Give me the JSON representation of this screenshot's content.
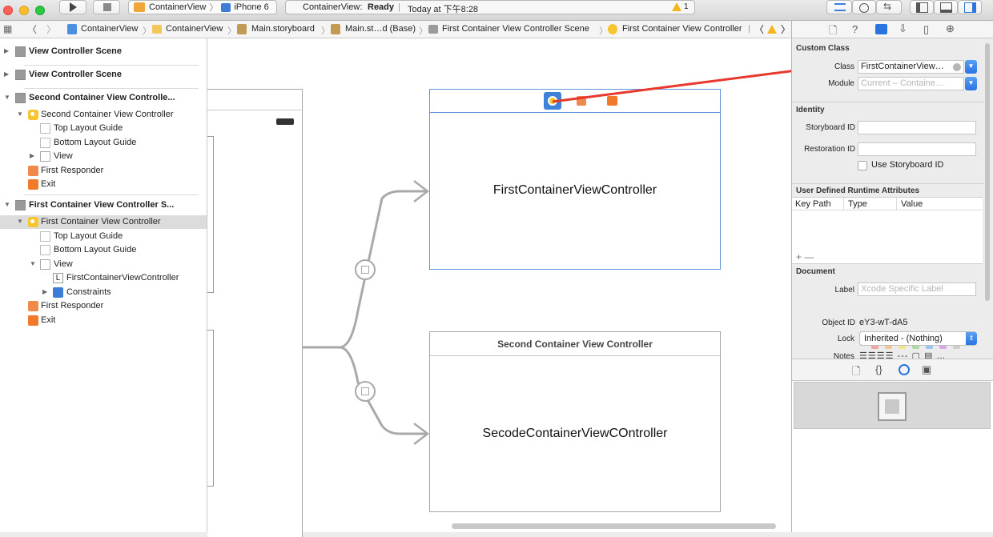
{
  "toolbar": {
    "scheme_project": "ContainerView",
    "scheme_device": "iPhone 6",
    "status_app": "ContainerView:",
    "status_state": "Ready",
    "status_time": "Today at 下午8:28",
    "warning_count": "1"
  },
  "jumpbar": {
    "crumbs": [
      "ContainerView",
      "ContainerView",
      "Main.storyboard",
      "Main.st…d (Base)",
      "First Container View Controller Scene",
      "First Container View Controller"
    ]
  },
  "outline": {
    "rows": [
      "View Controller Scene",
      "View Controller Scene",
      "Second Container View Controlle...",
      "Second Container View Controller",
      "Top Layout Guide",
      "Bottom Layout Guide",
      "View",
      "First Responder",
      "Exit",
      "First Container View Controller S...",
      "First Container View Controller",
      "Top Layout Guide",
      "Bottom Layout Guide",
      "View",
      "FirstContainerViewController",
      "Constraints",
      "First Responder",
      "Exit"
    ]
  },
  "canvas": {
    "first_vc_label": "FirstContainerViewController",
    "second_vc_header": "Second Container View Controller",
    "second_vc_label": "SecodeContainerViewCOntroller"
  },
  "inspector": {
    "custom_class_title": "Custom Class",
    "class_label": "Class",
    "class_value": "FirstContainerView…",
    "module_label": "Module",
    "module_placeholder": "Current – Containe…",
    "identity_title": "Identity",
    "storyboard_id_label": "Storyboard ID",
    "restoration_id_label": "Restoration ID",
    "use_storyboard_id": "Use Storyboard ID",
    "udra_title": "User Defined Runtime Attributes",
    "col_keypath": "Key Path",
    "col_type": "Type",
    "col_value": "Value",
    "add_remove": "+ —",
    "document_title": "Document",
    "label_label": "Label",
    "label_placeholder": "Xcode Specific Label",
    "color_clear": "✕",
    "object_id_label": "Object ID",
    "object_id_value": "eY3-wT-dA5",
    "lock_label": "Lock",
    "lock_value": "Inherited - (Nothing)",
    "notes_label": "Notes"
  },
  "colors": {
    "accent": "#2a74e0",
    "arrow": "#e8372c",
    "swatches": [
      "#f4a3a3",
      "#f6c48f",
      "#f4e48a",
      "#a8dca0",
      "#9cc6f2",
      "#d6a8e6",
      "#cfcfcf"
    ]
  }
}
